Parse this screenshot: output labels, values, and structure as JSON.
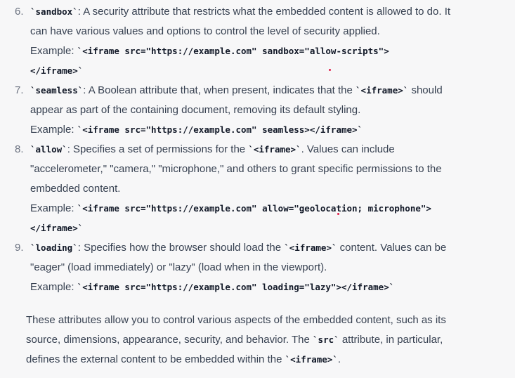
{
  "items": [
    {
      "number": "6.",
      "lines": [
        [
          {
            "code": "`sandbox`"
          },
          {
            "text": ": A security attribute that restricts what the embedded content is allowed to do. It"
          }
        ],
        [
          {
            "text": "can have various values and options to control the level of security applied."
          }
        ],
        [
          {
            "label": "Example: "
          },
          {
            "code": "`<iframe src=\"https://example.com\" sandbox=\"allow-scripts\">"
          }
        ],
        [
          {
            "code": "</iframe>`"
          }
        ]
      ]
    },
    {
      "number": "7.",
      "lines": [
        [
          {
            "code": "`seamless`"
          },
          {
            "text": ": A Boolean attribute that, when present, indicates that the "
          },
          {
            "code": "`<iframe>`"
          },
          {
            "text": " should"
          }
        ],
        [
          {
            "text": "appear as part of the containing document, removing its default styling."
          }
        ],
        [
          {
            "label": "Example: "
          },
          {
            "code": "`<iframe src=\"https://example.com\" seamless></iframe>`"
          }
        ]
      ]
    },
    {
      "number": "8.",
      "lines": [
        [
          {
            "code": "`allow`"
          },
          {
            "text": ": Specifies a set of permissions for the "
          },
          {
            "code": "`<iframe>`"
          },
          {
            "text": ". Values can include"
          }
        ],
        [
          {
            "text": "\"accelerometer,\" \"camera,\" \"microphone,\" and others to grant specific permissions to the"
          }
        ],
        [
          {
            "text": "embedded content."
          }
        ],
        [
          {
            "label": "Example: "
          },
          {
            "code": "`<iframe src=\"https://example.com\" allow=\"geolocation; microphone\">"
          }
        ],
        [
          {
            "code": "</iframe>`"
          }
        ]
      ]
    },
    {
      "number": "9.",
      "lines": [
        [
          {
            "code": "`loading`"
          },
          {
            "text": ": Specifies how the browser should load the "
          },
          {
            "code": "`<iframe>`"
          },
          {
            "text": " content. Values can be"
          }
        ],
        [
          {
            "text": "\"eager\" (load immediately) or \"lazy\" (load when in the viewport)."
          }
        ],
        [
          {
            "label": "Example: "
          },
          {
            "code": "`<iframe src=\"https://example.com\" loading=\"lazy\"></iframe>`"
          }
        ]
      ]
    }
  ],
  "summary": [
    [
      {
        "text": "These attributes allow you to control various aspects of the embedded content, such as its"
      }
    ],
    [
      {
        "text": "source, dimensions, appearance, security, and behavior. The "
      },
      {
        "code": "`src`"
      },
      {
        "text": " attribute, in particular,"
      }
    ],
    [
      {
        "text": "defines the external content to be embedded within the "
      },
      {
        "code": "`<iframe>`"
      },
      {
        "text": "."
      }
    ]
  ],
  "colors": {
    "background": "#f7f7f8",
    "text": "#374151",
    "code": "#111827",
    "cursor_dot": "#e11d48"
  }
}
